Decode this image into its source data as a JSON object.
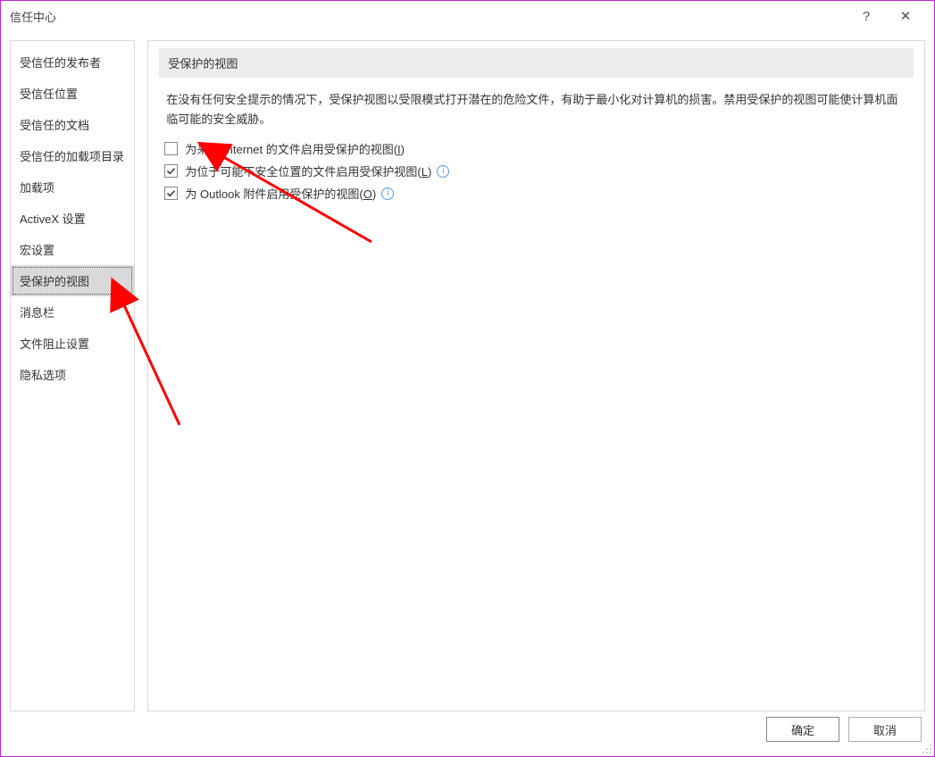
{
  "dialog": {
    "title": "信任中心",
    "help_symbol": "?",
    "close_symbol": "✕"
  },
  "sidebar": {
    "items": [
      {
        "label": "受信任的发布者",
        "selected": false
      },
      {
        "label": "受信任位置",
        "selected": false
      },
      {
        "label": "受信任的文档",
        "selected": false
      },
      {
        "label": "受信任的加载项目录",
        "selected": false
      },
      {
        "label": "加载项",
        "selected": false
      },
      {
        "label": "ActiveX 设置",
        "selected": false
      },
      {
        "label": "宏设置",
        "selected": false
      },
      {
        "label": "受保护的视图",
        "selected": true
      },
      {
        "label": "消息栏",
        "selected": false
      },
      {
        "label": "文件阻止设置",
        "selected": false
      },
      {
        "label": "隐私选项",
        "selected": false
      }
    ]
  },
  "content": {
    "section_title": "受保护的视图",
    "description": "在没有任何安全提示的情况下，受保护视图以受限模式打开潜在的危险文件，有助于最小化对计算机的损害。禁用受保护的视图可能使计算机面临可能的安全威胁。",
    "options": [
      {
        "label_pre": "为来自 Internet 的文件启用受保护的视图(",
        "accel": "I",
        "label_post": ")",
        "checked": false,
        "info": false
      },
      {
        "label_pre": "为位于可能不安全位置的文件启用受保护视图(",
        "accel": "L",
        "label_post": ")",
        "checked": true,
        "info": true
      },
      {
        "label_pre": "为 Outlook 附件启用受保护的视图(",
        "accel": "O",
        "label_post": ")",
        "checked": true,
        "info": true
      }
    ]
  },
  "footer": {
    "ok_label": "确定",
    "cancel_label": "取消"
  }
}
